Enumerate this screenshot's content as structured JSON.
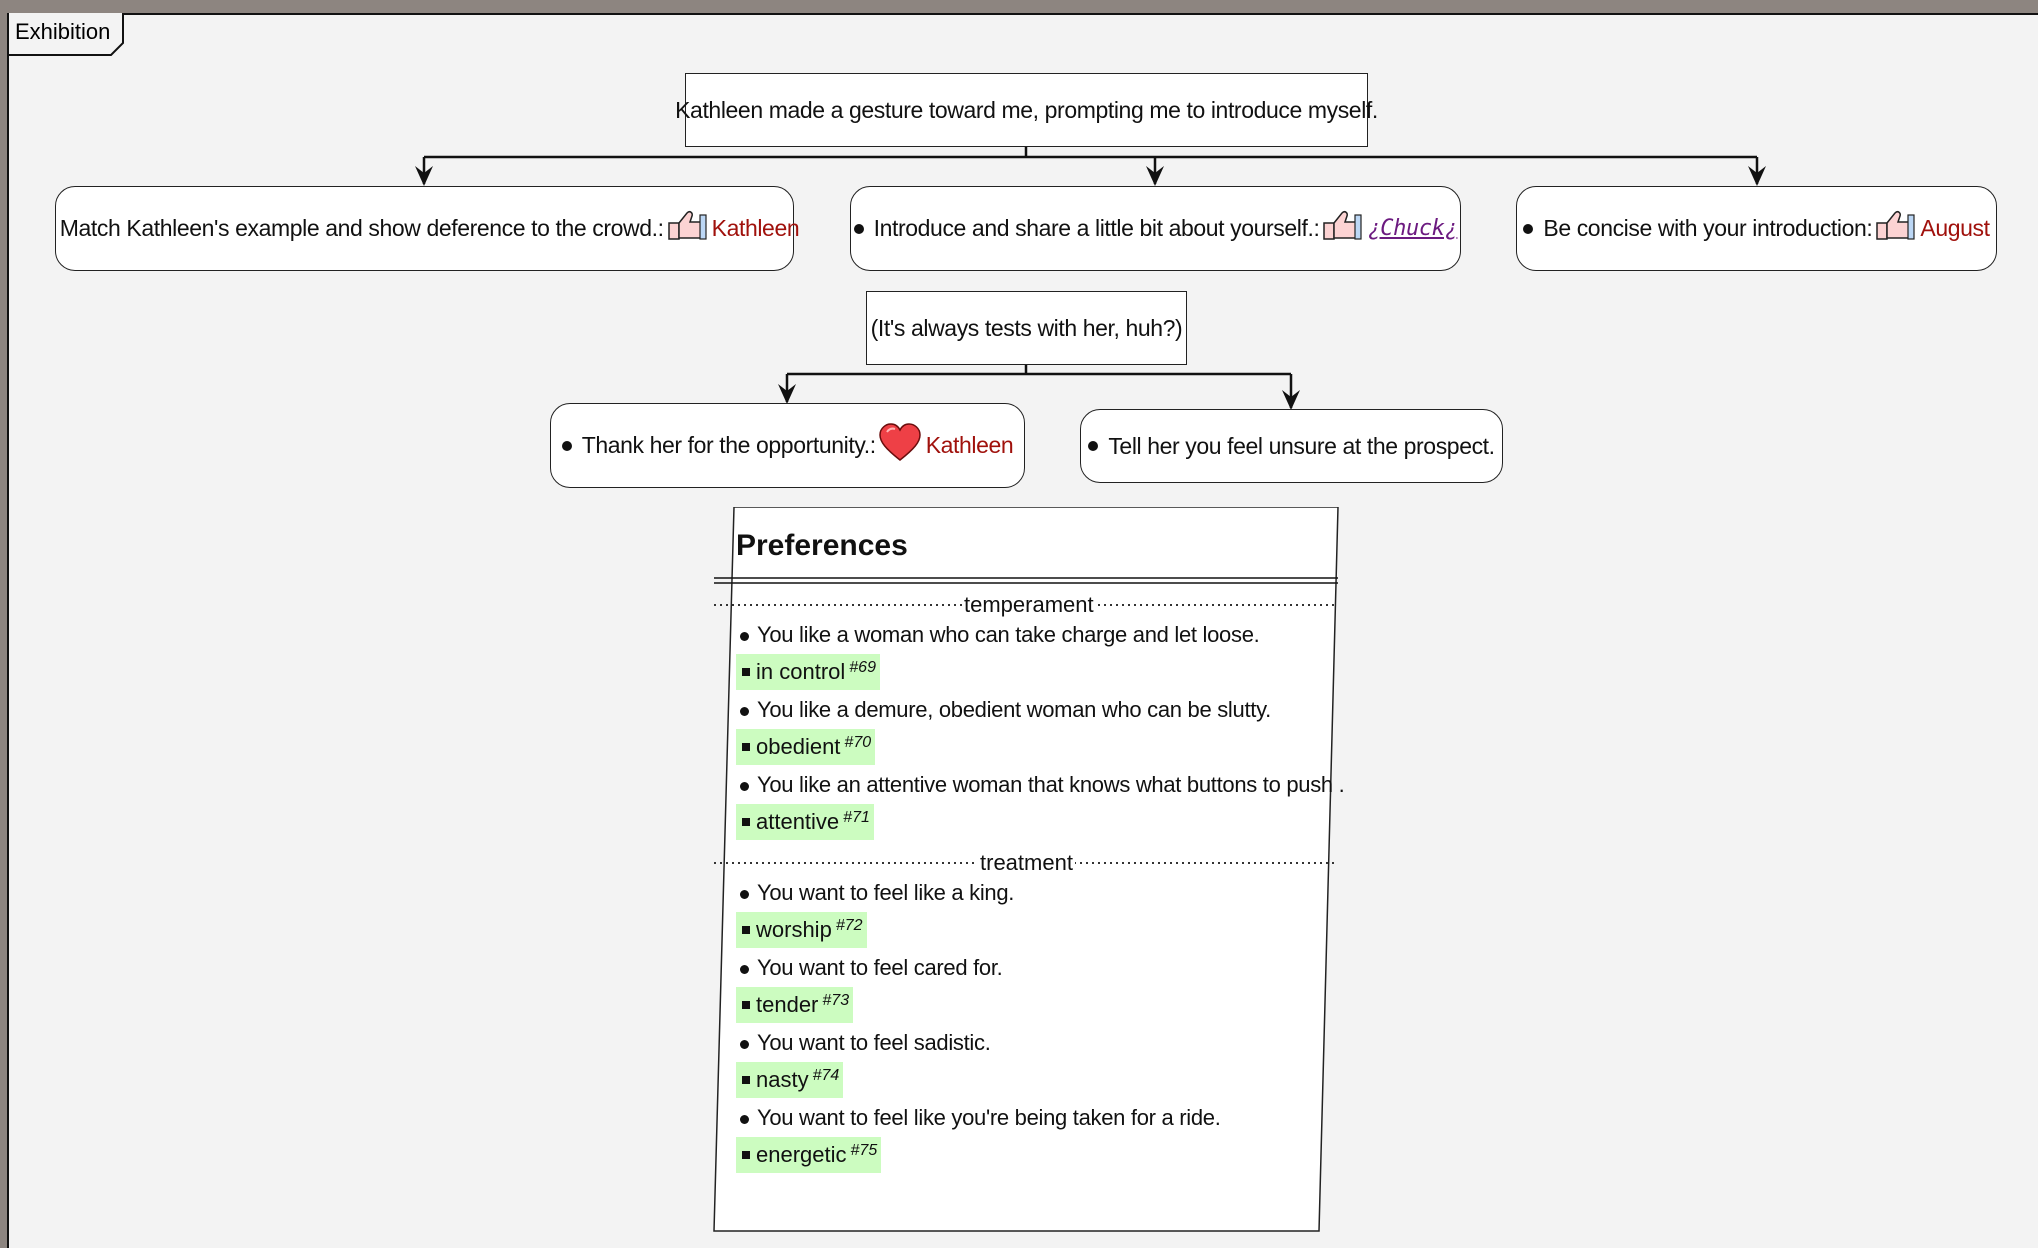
{
  "frame": {
    "title": "Exhibition"
  },
  "prompt1": {
    "text": "Kathleen made a gesture toward me, prompting me to introduce myself."
  },
  "choices1": [
    {
      "text": "Match Kathleen's example and show deference to the crowd.:",
      "icon": "thumbs-up-icon",
      "who": "Kathleen",
      "link": false
    },
    {
      "text": "Introduce and share a little bit about yourself.:",
      "icon": "thumbs-up-icon",
      "who": "¿Chuck¿",
      "link": true
    },
    {
      "text": "Be concise with your introduction:",
      "icon": "thumbs-up-icon",
      "who": "August",
      "link": false
    }
  ],
  "prompt2": {
    "text": "(It's always tests with her, huh?)"
  },
  "choices2": [
    {
      "text": "Thank her for the opportunity.:",
      "icon": "heart-icon",
      "who": "Kathleen"
    },
    {
      "text": "Tell her you feel unsure at the prospect."
    }
  ],
  "preferences": {
    "title": "Preferences",
    "sections": [
      {
        "label": "temperament",
        "items": [
          {
            "text": "You like a woman who can take charge and let loose.",
            "tag": "in control",
            "num": "#69"
          },
          {
            "text": "You like a demure, obedient woman who can be slutty.",
            "tag": "obedient",
            "num": "#70"
          },
          {
            "text": "You like an attentive woman that knows what buttons to push .",
            "tag": "attentive",
            "num": "#71"
          }
        ]
      },
      {
        "label": "treatment",
        "items": [
          {
            "text": "You want to feel like a king.",
            "tag": "worship",
            "num": "#72"
          },
          {
            "text": "You want to feel cared for.",
            "tag": "tender",
            "num": "#73"
          },
          {
            "text": "You want to feel sadistic.",
            "tag": "nasty",
            "num": "#74"
          },
          {
            "text": "You want to feel like you're being taken for a ride.",
            "tag": "energetic",
            "num": "#75"
          }
        ]
      }
    ]
  },
  "colors": {
    "who": "#a0110c",
    "link": "#6c1a80",
    "tag_bg": "#ccfcc0",
    "frame_bg": "#f3f3f3"
  }
}
